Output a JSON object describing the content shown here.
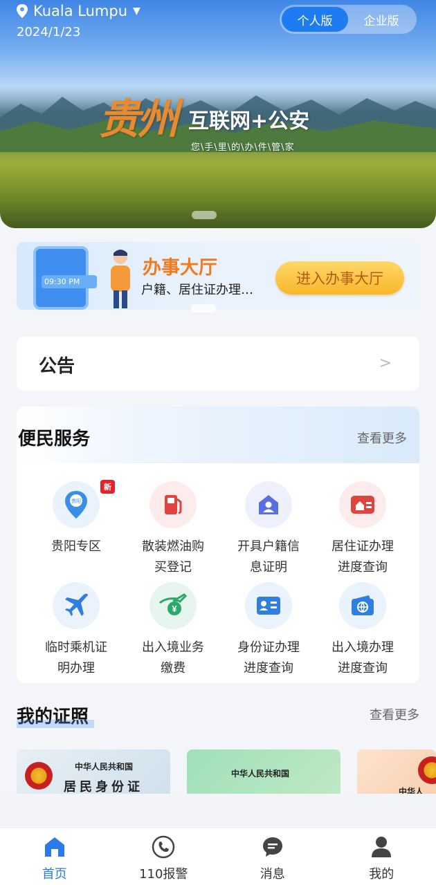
{
  "header": {
    "location": "Kuala Lumpu",
    "date": "2024/1/23",
    "modes": [
      "个人版",
      "企业版"
    ],
    "active_mode": "个人版"
  },
  "hero": {
    "place": "贵州",
    "headline": "互联网+公安",
    "slogan": "您\\手\\里\\的\\办\\件\\管\\家"
  },
  "banner": {
    "title": "办事大厅",
    "subtitle": "户籍、居住证办理…",
    "button": "进入办事大厅",
    "clock": "09:30 PM"
  },
  "notice": {
    "title": "公告",
    "arrow": ">"
  },
  "services": {
    "title": "便民服务",
    "more": "查看更多",
    "items": [
      {
        "line1": "贵阳专区",
        "line2": "",
        "icon": "guiyang-pin-icon",
        "badge": "新"
      },
      {
        "line1": "散装燃油购",
        "line2": "买登记",
        "icon": "fuel-pump-icon"
      },
      {
        "line1": "开具户籍信",
        "line2": "息证明",
        "icon": "household-user-icon"
      },
      {
        "line1": "居住证办理",
        "line2": "进度查询",
        "icon": "residence-card-icon"
      },
      {
        "line1": "临时乘机证",
        "line2": "明办理",
        "icon": "airplane-icon"
      },
      {
        "line1": "出入境业务",
        "line2": "缴费",
        "icon": "yuan-payment-icon"
      },
      {
        "line1": "身份证办理",
        "line2": "进度查询",
        "icon": "id-card-icon"
      },
      {
        "line1": "出入境办理",
        "line2": "进度查询",
        "icon": "passport-globe-icon"
      }
    ]
  },
  "licences": {
    "title": "我的证照",
    "more": "查看更多",
    "cards": [
      {
        "line1": "中华人民共和国",
        "line2": "居民身份证"
      },
      {
        "line1": "中华人民共和国",
        "line2": ""
      },
      {
        "line1": "中华人",
        "line2": ""
      }
    ]
  },
  "tabbar": {
    "items": [
      {
        "label": "首页",
        "icon": "home-icon"
      },
      {
        "label": "110报警",
        "icon": "phone-icon"
      },
      {
        "label": "消息",
        "icon": "message-icon"
      },
      {
        "label": "我的",
        "icon": "user-icon"
      }
    ],
    "active": "首页"
  },
  "colors": {
    "accent": "#2a7be8",
    "orange": "#f07a1e",
    "badge": "#e8202a"
  }
}
